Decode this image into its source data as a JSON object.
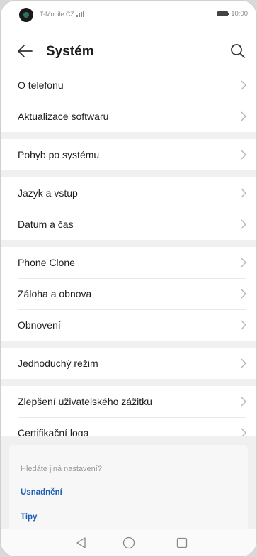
{
  "status_bar": {
    "carrier": "T-Mobile CZ",
    "time": "10:00"
  },
  "header": {
    "title": "Systém"
  },
  "groups": [
    {
      "items": [
        {
          "label": "O telefonu"
        },
        {
          "label": "Aktualizace softwaru"
        }
      ]
    },
    {
      "items": [
        {
          "label": "Pohyb po systému"
        }
      ]
    },
    {
      "items": [
        {
          "label": "Jazyk a vstup"
        },
        {
          "label": "Datum a čas"
        }
      ]
    },
    {
      "items": [
        {
          "label": "Phone Clone"
        },
        {
          "label": "Záloha a obnova"
        },
        {
          "label": "Obnovení"
        }
      ]
    },
    {
      "items": [
        {
          "label": "Jednoduchý režim"
        }
      ]
    },
    {
      "items": [
        {
          "label": "Zlepšení uživatelského zážitku"
        },
        {
          "label": "Certifikační loga"
        }
      ]
    }
  ],
  "suggestions": {
    "question": "Hledáte jiná nastavení?",
    "links": [
      "Usnadnění",
      "Tipy"
    ]
  },
  "icons": {
    "back": "back-arrow-icon",
    "search": "search-icon",
    "chevron": "chevron-right-icon",
    "nav_back": "triangle-back-icon",
    "nav_home": "circle-home-icon",
    "nav_recent": "square-recent-icon"
  },
  "colors": {
    "link": "#1a5fb4",
    "separator": "#f0f0f0",
    "text": "#1e1e1e"
  }
}
